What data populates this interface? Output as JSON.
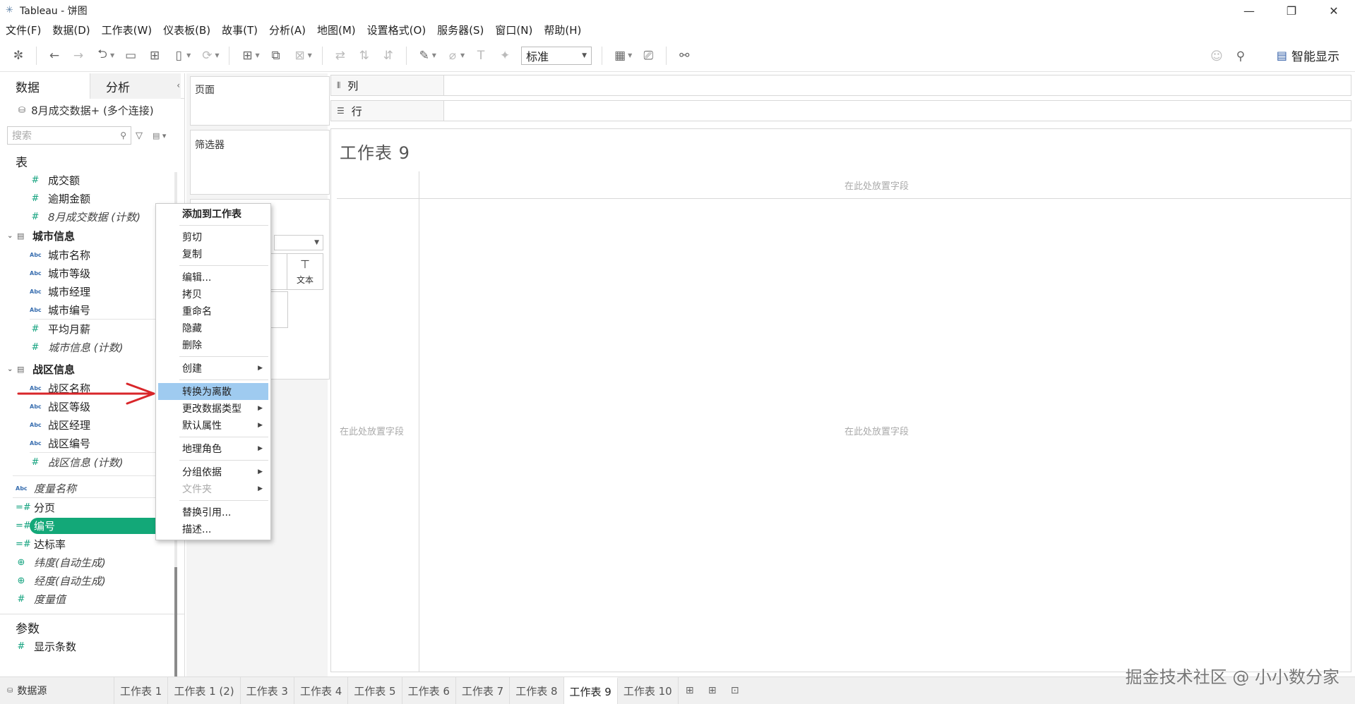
{
  "window": {
    "title": "Tableau - 饼图",
    "controls": [
      "—",
      "❐",
      "✕"
    ]
  },
  "menubar": [
    "文件(F)",
    "数据(D)",
    "工作表(W)",
    "仪表板(B)",
    "故事(T)",
    "分析(A)",
    "地图(M)",
    "设置格式(O)",
    "服务器(S)",
    "窗口(N)",
    "帮助(H)"
  ],
  "toolbar": {
    "standard_select": "标准",
    "smart_show": "智能显示"
  },
  "datapane": {
    "tab_data": "数据",
    "tab_analysis": "分析",
    "datasource": "8月成交数据+ (多个连接)",
    "search_placeholder": "搜索",
    "section_tables": "表",
    "top_fields": [
      {
        "label": "成交额",
        "type": "measure",
        "italic": false
      },
      {
        "label": "逾期金额",
        "type": "measure",
        "italic": false
      },
      {
        "label": "8月成交数据 (计数)",
        "type": "measure",
        "italic": true
      }
    ],
    "group_city": "城市信息",
    "city_fields": [
      {
        "label": "城市名称",
        "type": "dimension"
      },
      {
        "label": "城市等级",
        "type": "dimension"
      },
      {
        "label": "城市经理",
        "type": "dimension"
      },
      {
        "label": "城市编号",
        "type": "dimension"
      }
    ],
    "city_measures": [
      {
        "label": "平均月薪",
        "italic": false
      },
      {
        "label": "城市信息 (计数)",
        "italic": true
      }
    ],
    "group_zone": "战区信息",
    "zone_fields": [
      {
        "label": "战区名称",
        "type": "dimension"
      },
      {
        "label": "战区等级",
        "type": "dimension"
      },
      {
        "label": "战区经理",
        "type": "dimension"
      },
      {
        "label": "战区编号",
        "type": "dimension"
      }
    ],
    "zone_measure": "战区信息 (计数)",
    "extra_fields": [
      {
        "label": "度量名称",
        "icon": "Abc",
        "italic": true
      },
      {
        "label": "分页",
        "icon": "=#",
        "italic": false
      },
      {
        "label": "编号",
        "icon": "=#",
        "italic": false,
        "selected": true
      },
      {
        "label": "达标率",
        "icon": "=#",
        "italic": false
      },
      {
        "label": "纬度(自动生成)",
        "icon": "⊕",
        "italic": true
      },
      {
        "label": "经度(自动生成)",
        "icon": "⊕",
        "italic": true
      },
      {
        "label": "度量值",
        "icon": "#",
        "italic": true
      }
    ],
    "section_params": "参数",
    "param_field": "显示条数"
  },
  "shelves": {
    "pages": "页面",
    "filters": "筛选器",
    "columns": "列",
    "rows": "行",
    "text_button": "文本"
  },
  "viz": {
    "sheet_title": "工作表 9",
    "drop_top": "在此处放置字段",
    "drop_left": "在此处放置字段",
    "drop_center": "在此处放置字段"
  },
  "context_menu": [
    {
      "label": "添加到工作表",
      "bold": true
    },
    {
      "sep": true
    },
    {
      "label": "剪切"
    },
    {
      "label": "复制"
    },
    {
      "sep": true
    },
    {
      "label": "编辑..."
    },
    {
      "label": "拷贝"
    },
    {
      "label": "重命名"
    },
    {
      "label": "隐藏"
    },
    {
      "label": "删除"
    },
    {
      "sep": true
    },
    {
      "label": "创建",
      "submenu": true
    },
    {
      "sep": true
    },
    {
      "label": "转换为离散",
      "highlighted": true
    },
    {
      "label": "更改数据类型",
      "submenu": true
    },
    {
      "label": "默认属性",
      "submenu": true
    },
    {
      "sep": true
    },
    {
      "label": "地理角色",
      "submenu": true
    },
    {
      "sep": true
    },
    {
      "label": "分组依据",
      "submenu": true
    },
    {
      "label": "文件夹",
      "submenu": true,
      "disabled": true
    },
    {
      "sep": true
    },
    {
      "label": "替换引用..."
    },
    {
      "label": "描述..."
    }
  ],
  "bottom": {
    "datasource_tab": "数据源",
    "sheets": [
      "工作表 1",
      "工作表 1 (2)",
      "工作表 3",
      "工作表 4",
      "工作表 5",
      "工作表 6",
      "工作表 7",
      "工作表 8",
      "工作表 9",
      "工作表 10"
    ],
    "active_sheet": "工作表 9"
  },
  "watermark": "掘金技术社区 @ 小小数分家",
  "colors": {
    "accent_green": "#13a878",
    "menu_highlight": "#9fcbf0",
    "arrow_red": "#d9262a"
  }
}
